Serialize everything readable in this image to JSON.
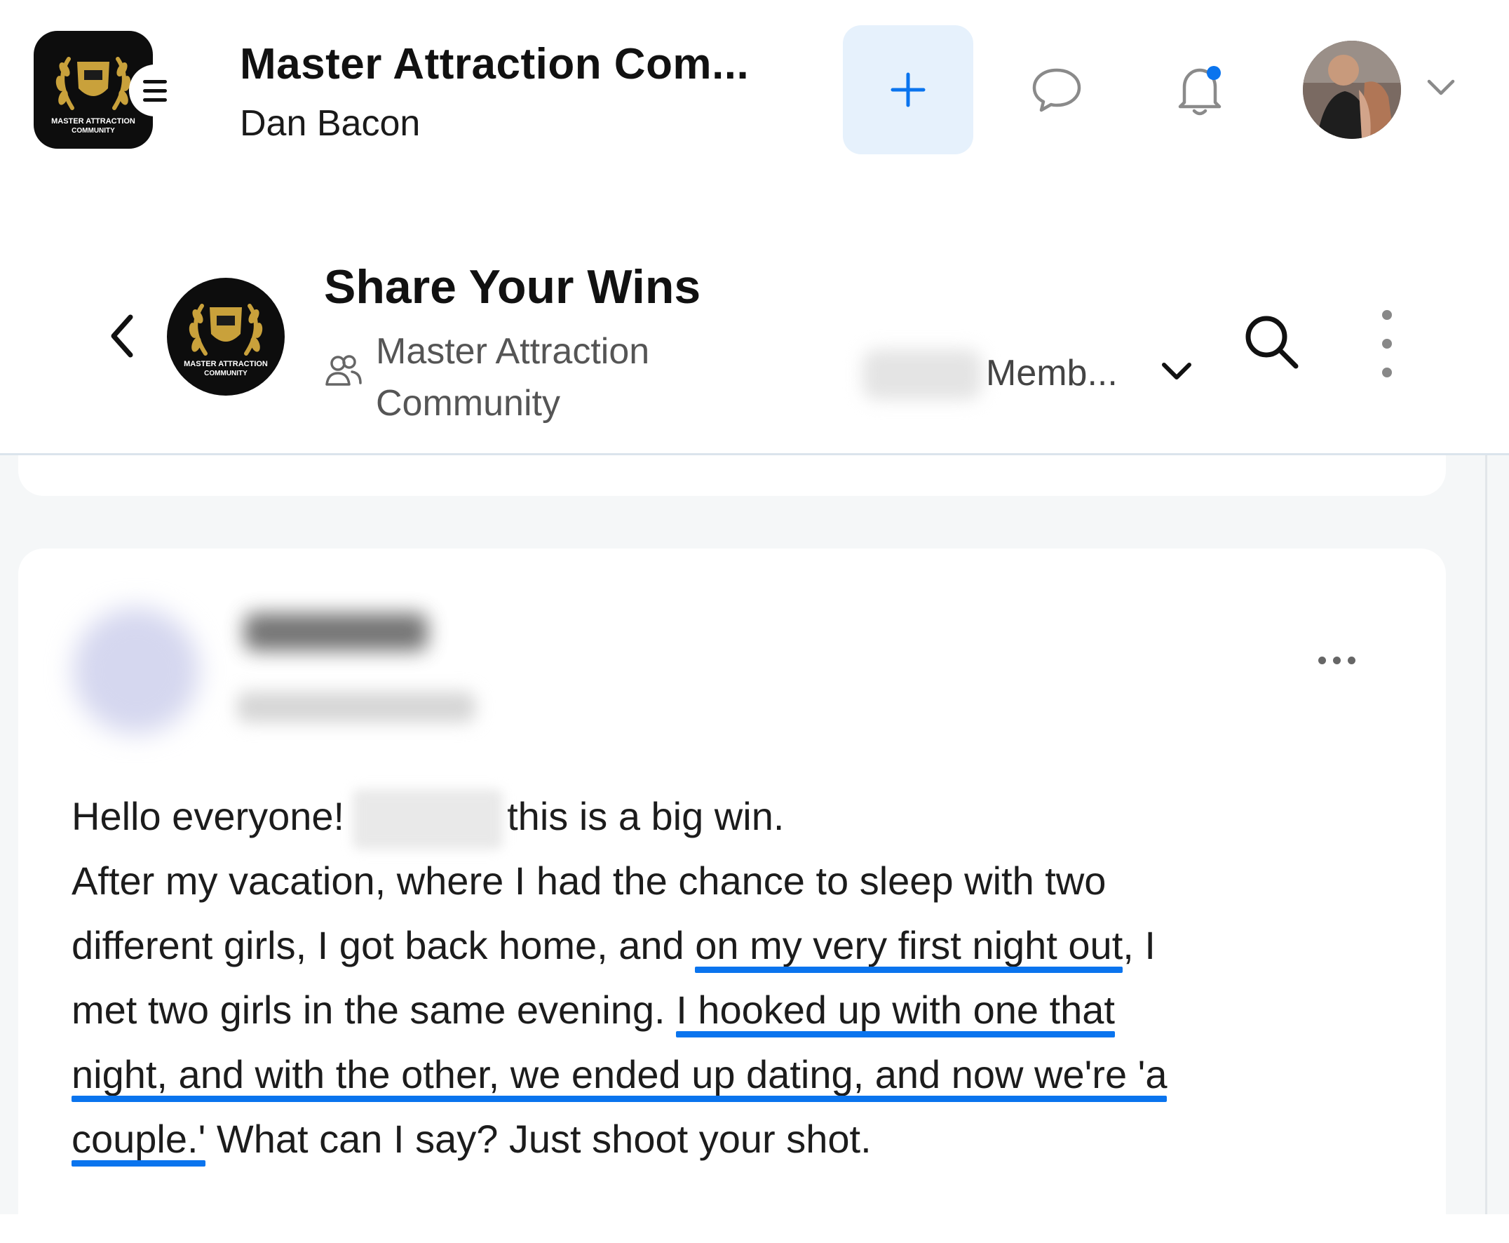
{
  "app": {
    "title": "Master Attraction Com...",
    "subtitle": "Dan Bacon",
    "logo_text": "MASTER ATTRACTION COMMUNITY",
    "accent_color": "#0a74ee",
    "plus_button_bg": "#e6f1fc",
    "icons": [
      "hamburger-icon",
      "plus-icon",
      "chat-icon",
      "bell-icon",
      "chevron-down-icon"
    ]
  },
  "space": {
    "title": "Share Your Wins",
    "community_line1": "Master Attraction",
    "community_line2": "Community",
    "members_label": "Memb...",
    "icons": [
      "back-icon",
      "community-icon",
      "search-icon",
      "more-vertical-icon"
    ]
  },
  "post": {
    "line1_a": "Hello everyone!",
    "line1_b": "this is a big win.",
    "line2": "After my vacation, where I had the chance to sleep with two",
    "line3_a": "different girls, I got back home, and ",
    "line3_hl": "on my very first night out",
    "line3_b": ", I",
    "line4_a": "met two girls in the same evening. ",
    "line4_hl": "I hooked up with one that",
    "line5_hl": "night, and with the other, we ended up dating, and now we're 'a",
    "line6_hl": "couple.'",
    "line6_b": " What can I say? Just shoot your shot.",
    "highlight_color": "#0a74ee"
  }
}
